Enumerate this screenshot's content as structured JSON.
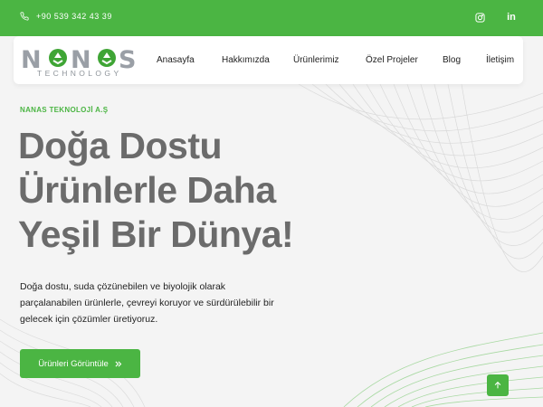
{
  "topbar": {
    "phone": "+90 539 342 43 39",
    "icons": [
      "phone-icon",
      "instagram-icon",
      "linkedin-icon"
    ],
    "linkedin_glyph": "in"
  },
  "brand": {
    "logo_text": "N  N  S",
    "logo_subtitle": "TECHNOLOGY"
  },
  "nav": {
    "items": [
      "Anasayfa",
      "Hakkımızda",
      "Ürünlerimiz",
      "Özel Projeler",
      "Blog",
      "İletişim"
    ]
  },
  "hero": {
    "eyebrow": "NANAS TEKNOLOJİ A.Ş",
    "headline": [
      "Doğa Dostu",
      "Ürünlerle Daha",
      "Yeşil Bir Dünya!"
    ],
    "description": "Doğa dostu, suda çözünebilen ve biyolojik olarak parçalanabilen ürünlerle, çevreyi koruyor ve sürdürülebilir bir gelecek için çözümler üretiyoruz.",
    "cta_label": "Ürünleri Görüntüle",
    "cta_icon": "double-chevron-right-icon"
  },
  "colors": {
    "brand_green": "#4bb543",
    "headline_gray": "#6b6b6b",
    "logo_gray": "#9a9fa6",
    "recycle_green": "#3fa535"
  }
}
